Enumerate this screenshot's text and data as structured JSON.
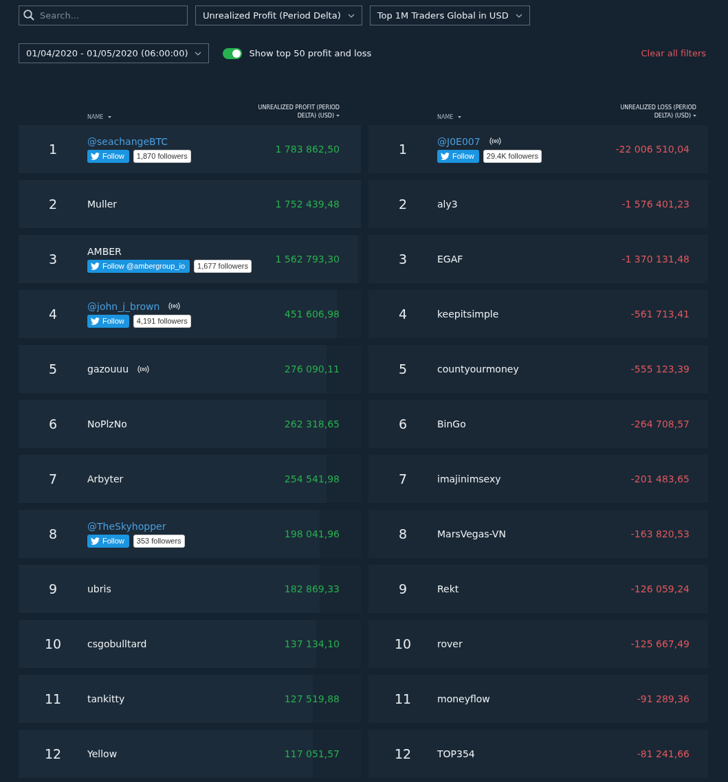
{
  "filters": {
    "search": {
      "placeholder": "Search..."
    },
    "metric": "Unrealized Profit (Period Delta)",
    "group": "Top 1M Traders Global in USD",
    "date_range": "01/04/2020 - 01/05/2020 (06:00:00)",
    "toggle": {
      "label": "Show top 50 profit and loss",
      "on": true
    },
    "clear": "Clear all filters"
  },
  "profit": {
    "name_header": "NAME",
    "value_header": "UNREALIZED PROFIT (PERIOD DELTA) (USD)",
    "rows": [
      {
        "rank": "1",
        "name": "@seachangeBTC",
        "kind": "twitter",
        "live": false,
        "follow": "Follow",
        "followers": "1,870 followers",
        "value": "1 783 862,50",
        "level": 1
      },
      {
        "rank": "2",
        "name": "Muller",
        "kind": "plain",
        "live": false,
        "value": "1 752 439,48",
        "level": 1
      },
      {
        "rank": "3",
        "name": "AMBER",
        "kind": "team",
        "live": false,
        "follow": "Follow @ambergroup_io",
        "followers": "1,677 followers",
        "value": "1 562 793,30",
        "level": 0.99
      },
      {
        "rank": "4",
        "name": "@john_j_brown",
        "kind": "twitter",
        "live": true,
        "follow": "Follow",
        "followers": "4,191 followers",
        "value": "451 606,98",
        "level": 0.93
      },
      {
        "rank": "5",
        "name": "gazouuu",
        "kind": "plain",
        "live": true,
        "value": "276 090,11",
        "level": 0.9
      },
      {
        "rank": "6",
        "name": "NoPlzNo",
        "kind": "plain",
        "live": false,
        "value": "262 318,65",
        "level": 0.9
      },
      {
        "rank": "7",
        "name": "Arbyter",
        "kind": "plain",
        "live": false,
        "value": "254 541,98",
        "level": 0.9
      },
      {
        "rank": "8",
        "name": "@TheSkyhopper",
        "kind": "twitter",
        "live": false,
        "follow": "Follow",
        "followers": "353 followers",
        "value": "198 041,96",
        "level": 0.88
      },
      {
        "rank": "9",
        "name": "ubris",
        "kind": "plain",
        "live": false,
        "value": "182 869,33",
        "level": 0.88
      },
      {
        "rank": "10",
        "name": "csgobulltard",
        "kind": "plain",
        "live": false,
        "value": "137 134,10",
        "level": 0.87
      },
      {
        "rank": "11",
        "name": "tankitty",
        "kind": "plain",
        "live": false,
        "value": "127 519,88",
        "level": 0.86
      },
      {
        "rank": "12",
        "name": "Yellow",
        "kind": "plain",
        "live": false,
        "value": "117 051,57",
        "level": 0.86
      }
    ]
  },
  "loss": {
    "name_header": "NAME",
    "value_header": "UNREALIZED LOSS (PERIOD DELTA) (USD)",
    "rows": [
      {
        "rank": "1",
        "name": "@J0E007",
        "kind": "twitter",
        "live": true,
        "follow": "Follow",
        "followers": "29.4K followers",
        "value": "-22 006 510,04"
      },
      {
        "rank": "2",
        "name": "aly3",
        "kind": "plain",
        "live": false,
        "value": "-1 576 401,23"
      },
      {
        "rank": "3",
        "name": "EGAF",
        "kind": "plain",
        "live": false,
        "value": "-1 370 131,48"
      },
      {
        "rank": "4",
        "name": "keepitsimple",
        "kind": "plain",
        "live": false,
        "value": "-561 713,41"
      },
      {
        "rank": "5",
        "name": "countyourmoney",
        "kind": "plain",
        "live": false,
        "value": "-555 123,39"
      },
      {
        "rank": "6",
        "name": "BinGo",
        "kind": "plain",
        "live": false,
        "value": "-264 708,57"
      },
      {
        "rank": "7",
        "name": "imajinimsexy",
        "kind": "plain",
        "live": false,
        "value": "-201 483,65"
      },
      {
        "rank": "8",
        "name": "MarsVegas-VN",
        "kind": "plain",
        "live": false,
        "value": "-163 820,53"
      },
      {
        "rank": "9",
        "name": "Rekt",
        "kind": "plain",
        "live": false,
        "value": "-126 059,24"
      },
      {
        "rank": "10",
        "name": "rover",
        "kind": "plain",
        "live": false,
        "value": "-125 667,49"
      },
      {
        "rank": "11",
        "name": "moneyflow",
        "kind": "plain",
        "live": false,
        "value": "-91 289,36"
      },
      {
        "rank": "12",
        "name": "TOP354",
        "kind": "plain",
        "live": false,
        "value": "-81 241,66"
      }
    ]
  }
}
